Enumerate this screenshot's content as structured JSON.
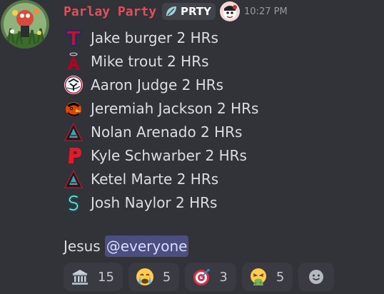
{
  "message": {
    "author": {
      "username": "Parlay Party",
      "tag": "PRTY",
      "tag_icon": "leaf-icon",
      "role_icon": "cartoon-face-icon",
      "avatar": "avatar-icon"
    },
    "timestamp": "10:27 PM",
    "lines": [
      {
        "text": "Jake burger 2 HRs",
        "team_icon": "rangers-logo-icon"
      },
      {
        "text": "Mike trout 2 HRs",
        "team_icon": "angels-logo-icon"
      },
      {
        "text": "Aaron Judge 2 HRs",
        "team_icon": "yankees-logo-icon"
      },
      {
        "text": "Jeremiah Jackson 2 HRs",
        "team_icon": "orioles-logo-icon"
      },
      {
        "text": "Nolan Arenado 2 HRs",
        "team_icon": "diamondbacks-logo-icon"
      },
      {
        "text": "Kyle Schwarber 2 HRs",
        "team_icon": "phillies-logo-icon"
      },
      {
        "text": "Ketel Marte 2 HRs",
        "team_icon": "diamondbacks-logo-icon"
      },
      {
        "text": "Josh Naylor 2 HRs",
        "team_icon": "mariners-logo-icon"
      }
    ],
    "footer_text": "Jesus",
    "mention": "@everyone"
  },
  "reactions": [
    {
      "icon": "bank-icon",
      "count": "15"
    },
    {
      "icon": "crying-face-icon",
      "count": "5"
    },
    {
      "icon": "bullseye-icon",
      "count": "3"
    },
    {
      "icon": "vomiting-face-icon",
      "count": "5"
    }
  ],
  "add_reaction_icon": "add-reaction-icon",
  "colors": {
    "background": "#323339",
    "username": "#e0505a",
    "text": "#dbdee1",
    "timestamp": "#949ba4",
    "mention_bg": "#4b4e7e",
    "reaction_bg": "#3a3b42"
  }
}
